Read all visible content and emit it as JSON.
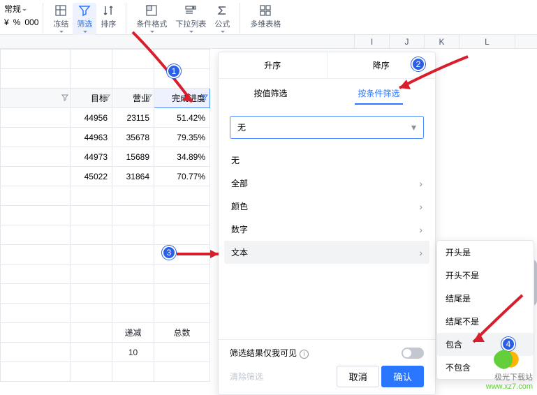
{
  "toolbar": {
    "format": "常规",
    "currency": "¥",
    "percent": "%",
    "formatChange": "000",
    "freeze_label": "冻结",
    "filter_label": "筛选",
    "sort_label": "排序",
    "condfmt_label": "条件格式",
    "dropdown_label": "下拉列表",
    "formula_label": "公式",
    "pivot_label": "多维表格"
  },
  "columns": [
    "I",
    "J",
    "K",
    "L"
  ],
  "headers": {
    "goal": "目标",
    "biz": "营业",
    "progress": "完成进度"
  },
  "rows": [
    {
      "goal": "44956",
      "biz": "23115",
      "progress": "51.42%"
    },
    {
      "goal": "44963",
      "biz": "35678",
      "progress": "79.35%"
    },
    {
      "goal": "44973",
      "biz": "15689",
      "progress": "34.89%"
    },
    {
      "goal": "45022",
      "biz": "31864",
      "progress": "70.77%"
    }
  ],
  "summary": {
    "label_dec": "递减",
    "label_total": "总数",
    "value": "10"
  },
  "panel": {
    "asc": "升序",
    "desc": "降序",
    "by_value": "按值筛选",
    "by_cond": "按条件筛选",
    "select_value": "无",
    "options": {
      "none": "无",
      "all": "全部",
      "color": "颜色",
      "number": "数字",
      "text": "文本"
    },
    "only_me": "筛选结果仅我可见",
    "clear": "清除筛选",
    "cancel": "取消",
    "confirm": "确认"
  },
  "submenu": {
    "starts": "开头是",
    "not_starts": "开头不是",
    "ends": "结尾是",
    "not_ends": "结尾不是",
    "contains": "包含",
    "not_contains": "不包含"
  },
  "watermark": {
    "name": "极光下载站",
    "url": "www.xz7.com"
  }
}
